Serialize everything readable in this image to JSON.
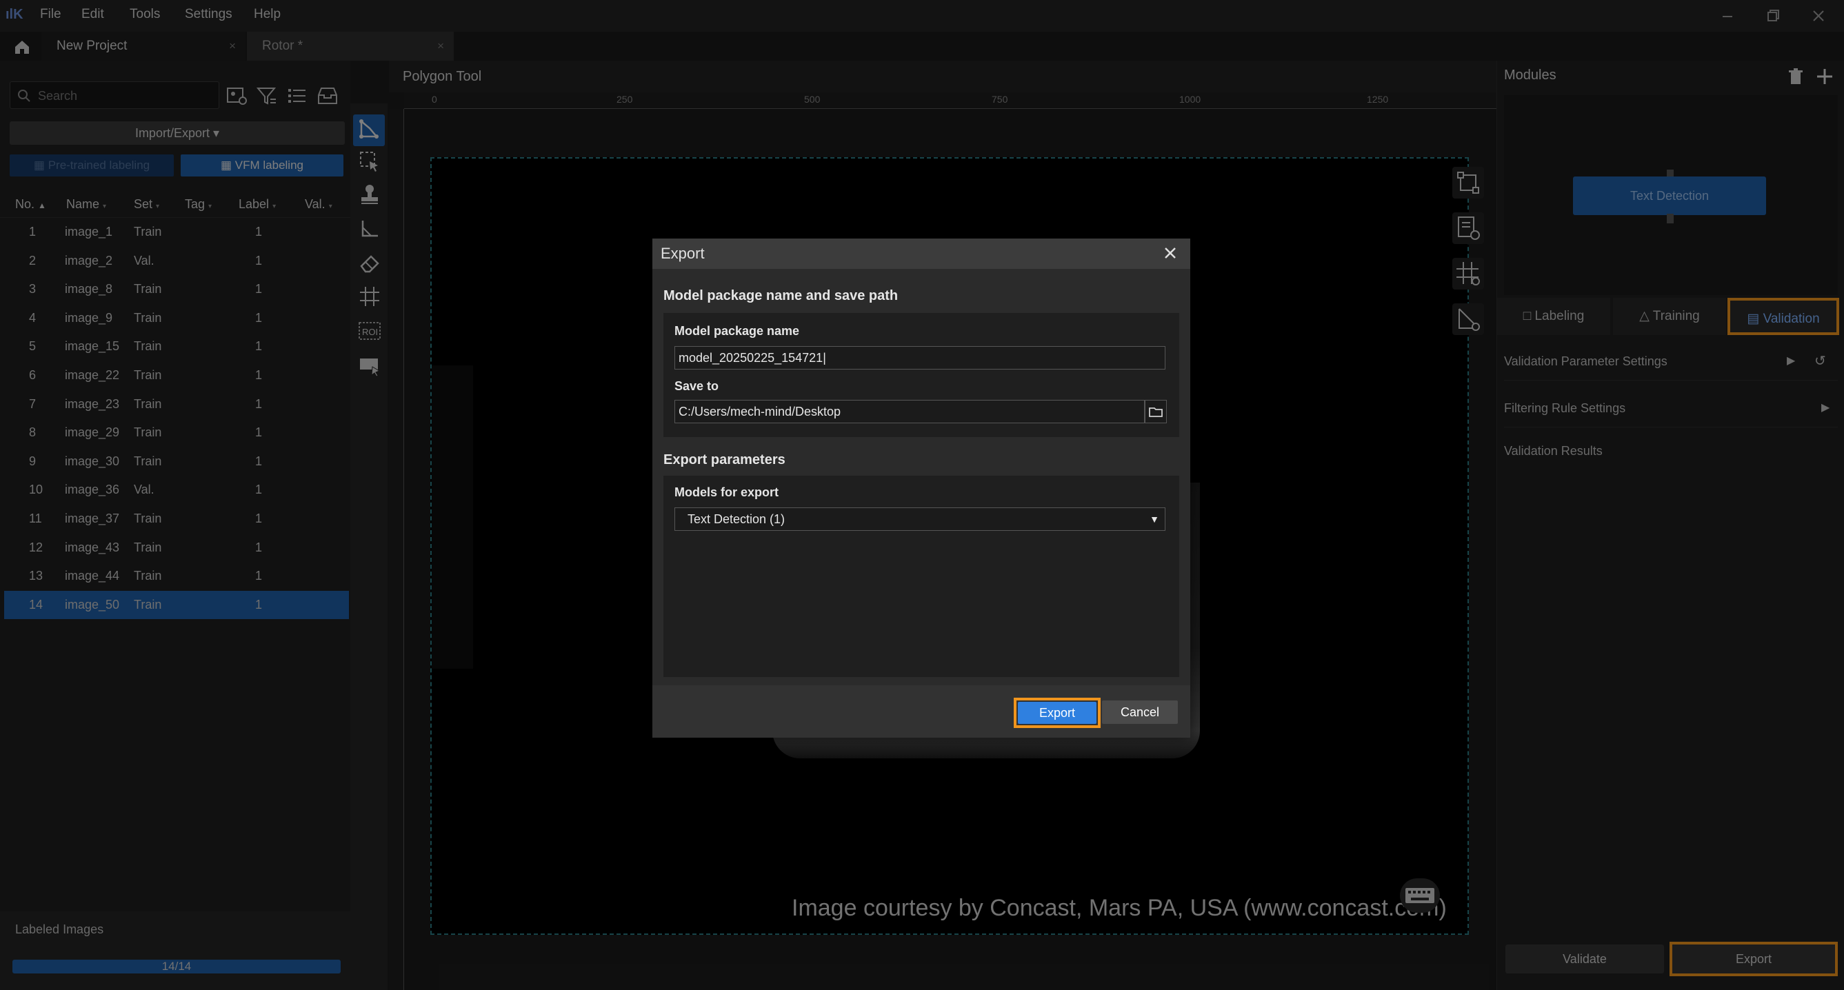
{
  "menu": {
    "logo": "ılK",
    "items": [
      "File",
      "Edit",
      "Tools",
      "Settings",
      "Help"
    ]
  },
  "tabs": [
    {
      "label": "New Project",
      "close": "×"
    },
    {
      "label": "Rotor *",
      "close": "×"
    }
  ],
  "left": {
    "search_placeholder": "Search",
    "import_export": "Import/Export",
    "pretrained_label": "Pre-trained labeling",
    "vfm_label": "VFM labeling",
    "columns": [
      "No.",
      "Name",
      "Set",
      "Tag",
      "Label",
      "Val."
    ],
    "rows": [
      {
        "no": "1",
        "name": "image_1",
        "set": "Train",
        "label": "1"
      },
      {
        "no": "2",
        "name": "image_2",
        "set": "Val.",
        "label": "1"
      },
      {
        "no": "3",
        "name": "image_8",
        "set": "Train",
        "label": "1"
      },
      {
        "no": "4",
        "name": "image_9",
        "set": "Train",
        "label": "1"
      },
      {
        "no": "5",
        "name": "image_15",
        "set": "Train",
        "label": "1"
      },
      {
        "no": "6",
        "name": "image_22",
        "set": "Train",
        "label": "1"
      },
      {
        "no": "7",
        "name": "image_23",
        "set": "Train",
        "label": "1"
      },
      {
        "no": "8",
        "name": "image_29",
        "set": "Train",
        "label": "1"
      },
      {
        "no": "9",
        "name": "image_30",
        "set": "Train",
        "label": "1"
      },
      {
        "no": "10",
        "name": "image_36",
        "set": "Val.",
        "label": "1"
      },
      {
        "no": "11",
        "name": "image_37",
        "set": "Train",
        "label": "1"
      },
      {
        "no": "12",
        "name": "image_43",
        "set": "Train",
        "label": "1"
      },
      {
        "no": "13",
        "name": "image_44",
        "set": "Train",
        "label": "1"
      },
      {
        "no": "14",
        "name": "image_50",
        "set": "Train",
        "label": "1"
      }
    ],
    "selected_row": "14",
    "labeled_title": "Labeled Images",
    "labeled_progress": "14/14",
    "labeled_fraction": 1.0
  },
  "canvas": {
    "title": "Polygon Tool",
    "ruler_ticks": [
      "0",
      "250",
      "500",
      "750",
      "1000",
      "1250"
    ],
    "courtesy": "Image courtesy by Concast, Mars PA, USA (www.concast.com)"
  },
  "right": {
    "title": "Modules",
    "module_node": "Text Detection",
    "tabs": [
      "Labeling",
      "Training",
      "Validation"
    ],
    "active_tab": "Validation",
    "sections": [
      "Validation Parameter Settings",
      "Filtering Rule Settings",
      "Validation Results"
    ],
    "validate_button": "Validate",
    "export_button": "Export"
  },
  "dialog": {
    "title": "Export",
    "section1": "Model package name and save path",
    "name_label": "Model package name",
    "name_value": "model_20250225_154721",
    "save_label": "Save to",
    "save_value": "C:/Users/mech-mind/Desktop",
    "section2": "Export parameters",
    "models_label": "Models for export",
    "models_value": "Text Detection (1)",
    "export_button": "Export",
    "cancel_button": "Cancel"
  },
  "colors": {
    "accent": "#1f5fa8",
    "highlight": "#f0951e",
    "dashed": "#2a7d86"
  }
}
